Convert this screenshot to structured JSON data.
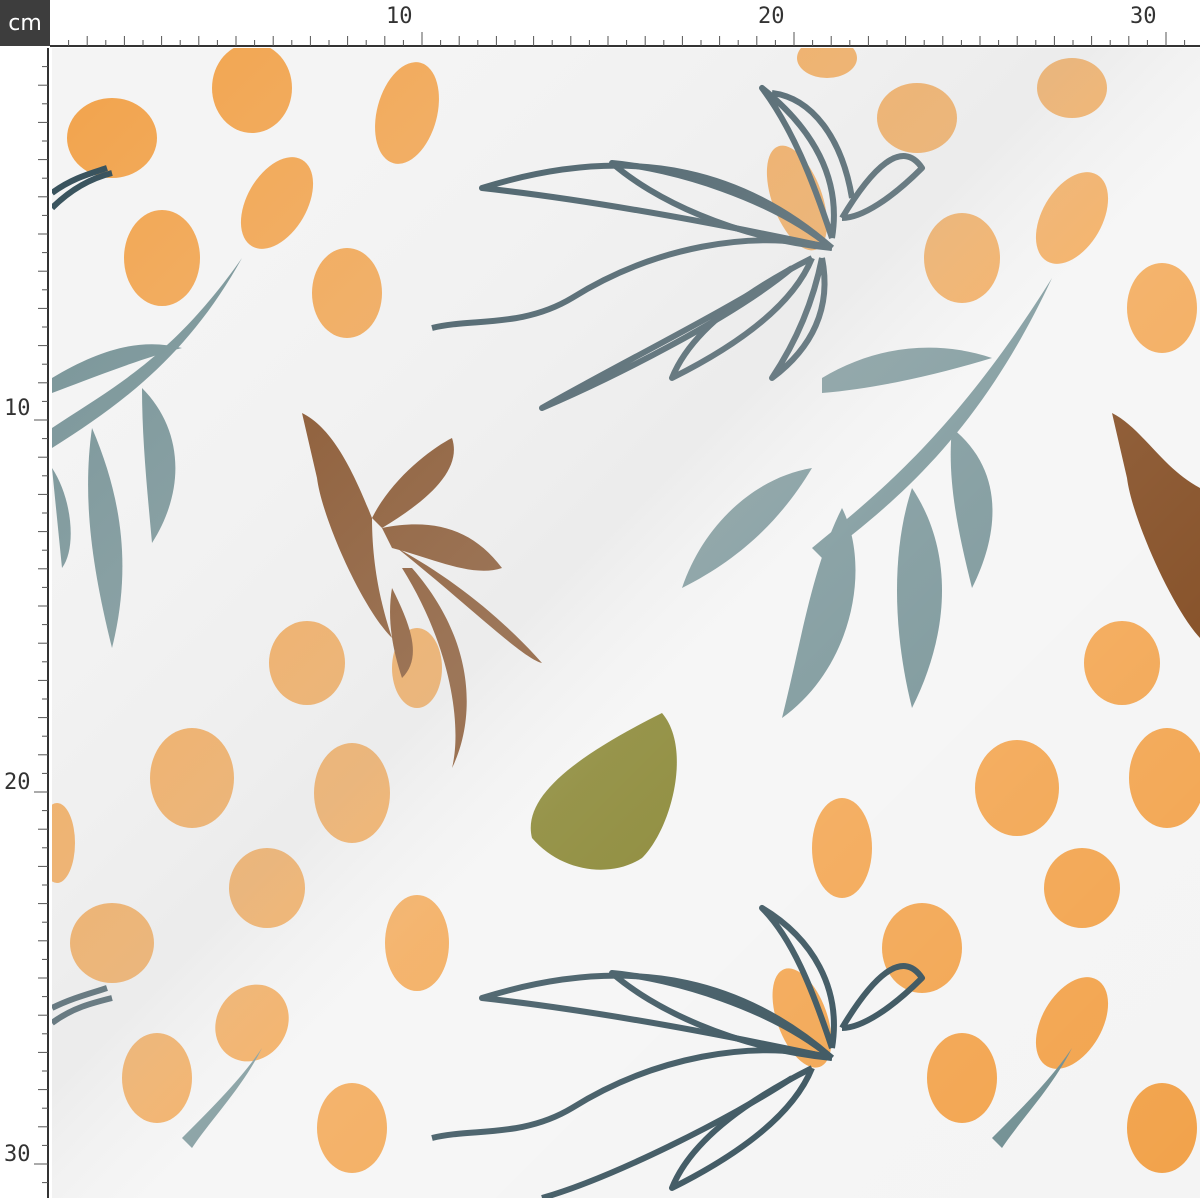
{
  "ruler": {
    "unit": "cm",
    "top_labels": [
      "10",
      "20",
      "30"
    ],
    "left_labels": [
      "10",
      "20",
      "30"
    ]
  },
  "colors": {
    "background": "#f4f4f4",
    "orange_dot": "#f2a24a",
    "dark_outline": "#2f4a55",
    "sage_leaf": "#6f8d91",
    "brown_leaf": "#7a3f12",
    "olive_leaf": "#7d7a1e"
  }
}
